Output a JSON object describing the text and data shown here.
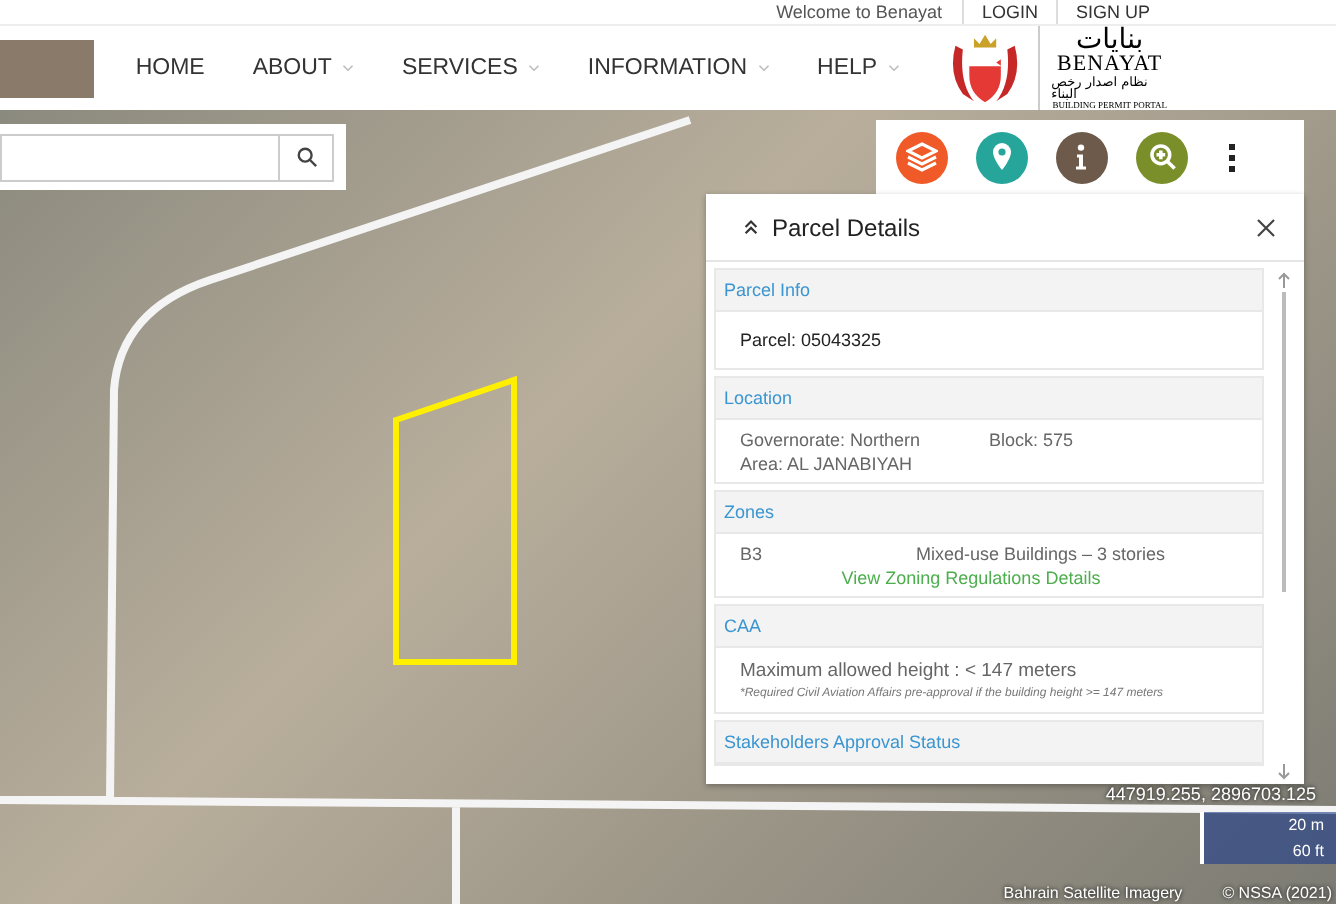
{
  "top_bar": {
    "welcome": "Welcome to Benayat",
    "links": [
      "LOGIN",
      "SIGN UP"
    ]
  },
  "nav": {
    "items": [
      {
        "label": "HOME",
        "dropdown": false
      },
      {
        "label": "ABOUT",
        "dropdown": true
      },
      {
        "label": "SERVICES",
        "dropdown": true
      },
      {
        "label": "INFORMATION",
        "dropdown": true
      },
      {
        "label": "HELP",
        "dropdown": true
      }
    ]
  },
  "brand": {
    "arabic_name": "بنايات",
    "name": "BENAYAT",
    "arabic_tagline": "نظام اصدار رخص البناء",
    "tagline": "BUILDING PERMIT PORTAL"
  },
  "panel": {
    "title": "Parcel Details",
    "sections": [
      {
        "title": "Parcel Info",
        "kind": "lines",
        "lines": [
          "Parcel: 05043325"
        ]
      },
      {
        "title": "Location",
        "kind": "grid",
        "items": [
          "Governorate: Northern",
          "Block: 575",
          "Area: AL JANABIYAH"
        ]
      },
      {
        "title": "Zones",
        "kind": "zone",
        "code": "B3",
        "description": "Mixed-use Buildings – 3 stories",
        "link": "View Zoning Regulations Details"
      },
      {
        "title": "CAA",
        "kind": "caa",
        "text": "Maximum allowed height : < 147 meters",
        "note": "*Required Civil Aviation Affairs pre-approval if the building height >= 147 meters"
      },
      {
        "title": "Stakeholders Approval Status",
        "kind": "header"
      }
    ]
  },
  "map": {
    "coordinates": "447919.255, 2896703.125",
    "scale": [
      "20 m",
      "60 ft"
    ],
    "attribution": [
      "Bahrain Satellite Imagery",
      "© NSSA (2021)"
    ]
  }
}
